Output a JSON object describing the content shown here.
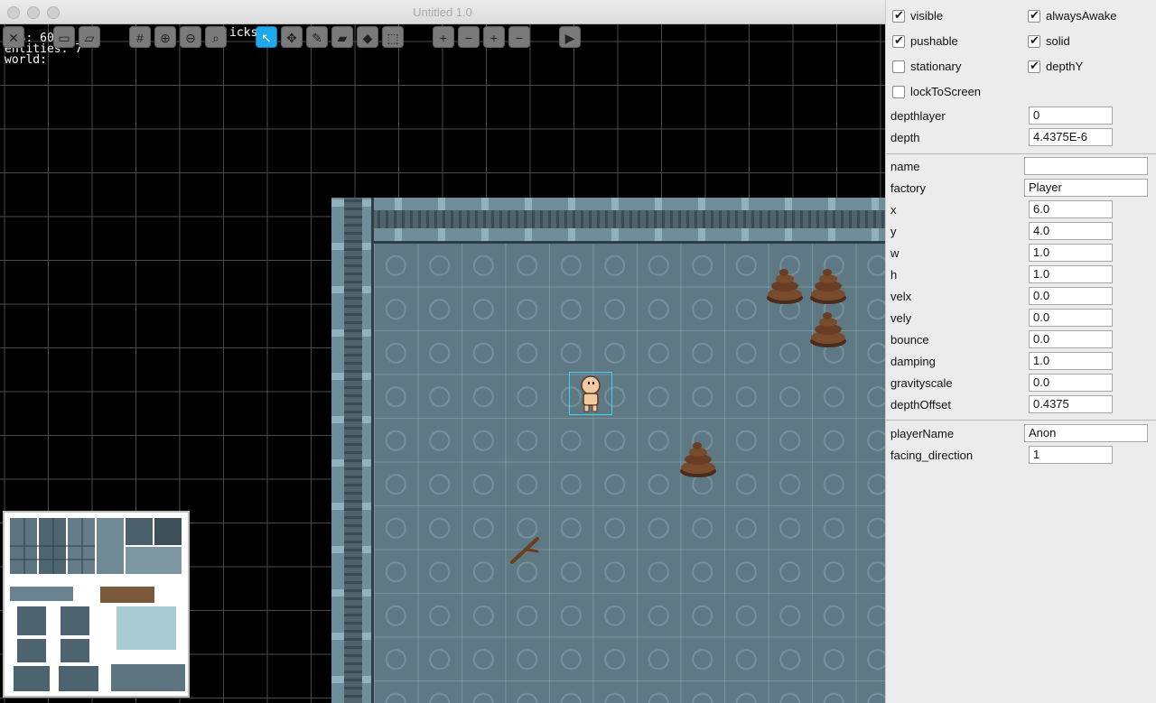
{
  "window": {
    "title": "Untitled 1.0"
  },
  "debug": {
    "fps": "FPS: 60",
    "entities": "entities: 7",
    "world": "world:"
  },
  "toolbar": {
    "click_label": "icks",
    "buttons": [
      {
        "name": "close-file-button",
        "icon": "close-icon",
        "glyph": "✕"
      },
      {
        "name": "save-button",
        "icon": "save-icon",
        "glyph": "▭"
      },
      {
        "name": "open-button",
        "icon": "folder-icon",
        "glyph": "▱"
      },
      {
        "name": "grid-toggle-button",
        "icon": "grid-icon",
        "glyph": "#"
      },
      {
        "name": "zoom-in-button",
        "icon": "zoom-in-icon",
        "glyph": "⊕"
      },
      {
        "name": "zoom-out-button",
        "icon": "zoom-out-icon",
        "glyph": "⊖"
      },
      {
        "name": "zoom-100-button",
        "icon": "zoom-100-icon",
        "glyph": "⌕"
      },
      {
        "name": "select-tool-button",
        "icon": "arrow-cursor-icon",
        "glyph": "↖",
        "active": true
      },
      {
        "name": "move-tool-button",
        "icon": "move-icon",
        "glyph": "✥"
      },
      {
        "name": "pencil-tool-button",
        "icon": "pencil-icon",
        "glyph": "✎"
      },
      {
        "name": "eraser-tool-button",
        "icon": "eraser-icon",
        "glyph": "▰"
      },
      {
        "name": "fill-tool-button",
        "icon": "bucket-icon",
        "glyph": "◆"
      },
      {
        "name": "marquee-tool-button",
        "icon": "marquee-icon",
        "glyph": "⬚"
      },
      {
        "name": "add-column-button",
        "icon": "add-column-icon",
        "glyph": "+"
      },
      {
        "name": "remove-column-button",
        "icon": "remove-column-icon",
        "glyph": "−"
      },
      {
        "name": "add-row-button",
        "icon": "add-row-icon",
        "glyph": "+"
      },
      {
        "name": "remove-row-button",
        "icon": "remove-row-icon",
        "glyph": "−"
      },
      {
        "name": "play-button",
        "icon": "play-icon",
        "glyph": "▶"
      }
    ]
  },
  "panel": {
    "checkboxes": [
      {
        "label": "visible",
        "checked": true
      },
      {
        "label": "alwaysAwake",
        "checked": true
      },
      {
        "label": "pushable",
        "checked": true
      },
      {
        "label": "solid",
        "checked": true
      },
      {
        "label": "stationary",
        "checked": false
      },
      {
        "label": "depthY",
        "checked": true
      },
      {
        "label": "lockToScreen",
        "checked": false
      }
    ],
    "depth_fields": [
      {
        "label": "depthlayer",
        "value": "0"
      },
      {
        "label": "depth",
        "value": "4.4375E-6"
      }
    ],
    "entity_fields": [
      {
        "label": "name",
        "value": ""
      },
      {
        "label": "factory",
        "value": "Player"
      },
      {
        "label": "x",
        "value": "6.0"
      },
      {
        "label": "y",
        "value": "4.0"
      },
      {
        "label": "w",
        "value": "1.0"
      },
      {
        "label": "h",
        "value": "1.0"
      },
      {
        "label": "velx",
        "value": "0.0"
      },
      {
        "label": "vely",
        "value": "0.0"
      },
      {
        "label": "bounce",
        "value": "0.0"
      },
      {
        "label": "damping",
        "value": "1.0"
      },
      {
        "label": "gravityscale",
        "value": "0.0"
      },
      {
        "label": "depthOffset",
        "value": "0.4375"
      }
    ],
    "custom_fields": [
      {
        "label": "playerName",
        "value": "Anon"
      },
      {
        "label": "facing_direction",
        "value": "1"
      }
    ]
  }
}
